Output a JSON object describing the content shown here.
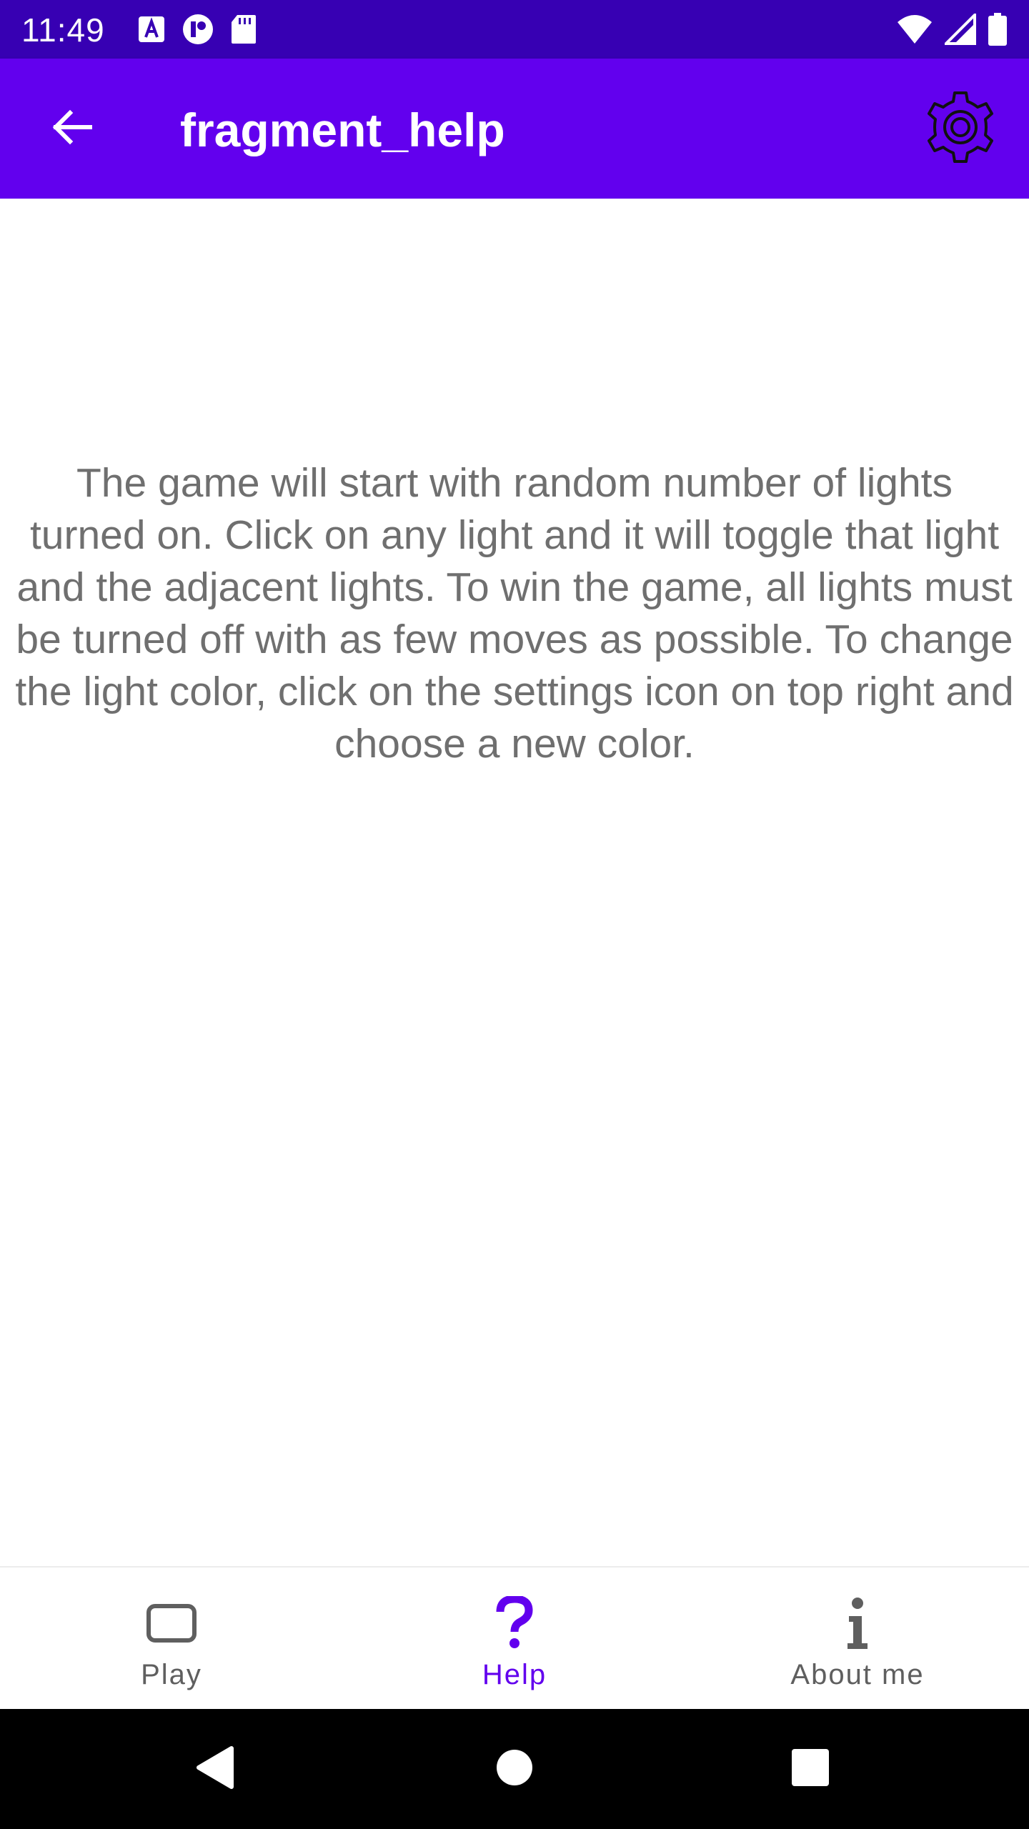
{
  "status_bar": {
    "time": "11:49",
    "left_icons": [
      "a-notification-icon",
      "circle-notification-icon",
      "sd-card-icon"
    ],
    "right_icons": [
      "wifi-icon",
      "cell-signal-icon",
      "battery-icon"
    ]
  },
  "app_bar": {
    "title": "fragment_help",
    "back_icon": "arrow-back-icon",
    "settings_icon": "gear-icon"
  },
  "content": {
    "help_text": "The game will start with random number of lights turned on. Click on any light and it will toggle that light and the adjacent lights. To win the game, all lights must be turned off with as few moves as possible. To change the light color, click on the settings icon on top right and choose a new color."
  },
  "bottom_nav": {
    "items": [
      {
        "label": "Play",
        "icon": "rounded-square-icon",
        "active": false
      },
      {
        "label": "Help",
        "icon": "question-mark-icon",
        "active": true
      },
      {
        "label": "About me",
        "icon": "info-icon",
        "active": false
      }
    ]
  },
  "system_nav": {
    "icons": [
      "back-triangle-icon",
      "home-circle-icon",
      "recents-square-icon"
    ]
  },
  "colors": {
    "status_bar": "#3700b3",
    "primary": "#6200ee",
    "text_secondary": "#6f6f6f",
    "nav_inactive": "#5f5f5f"
  }
}
